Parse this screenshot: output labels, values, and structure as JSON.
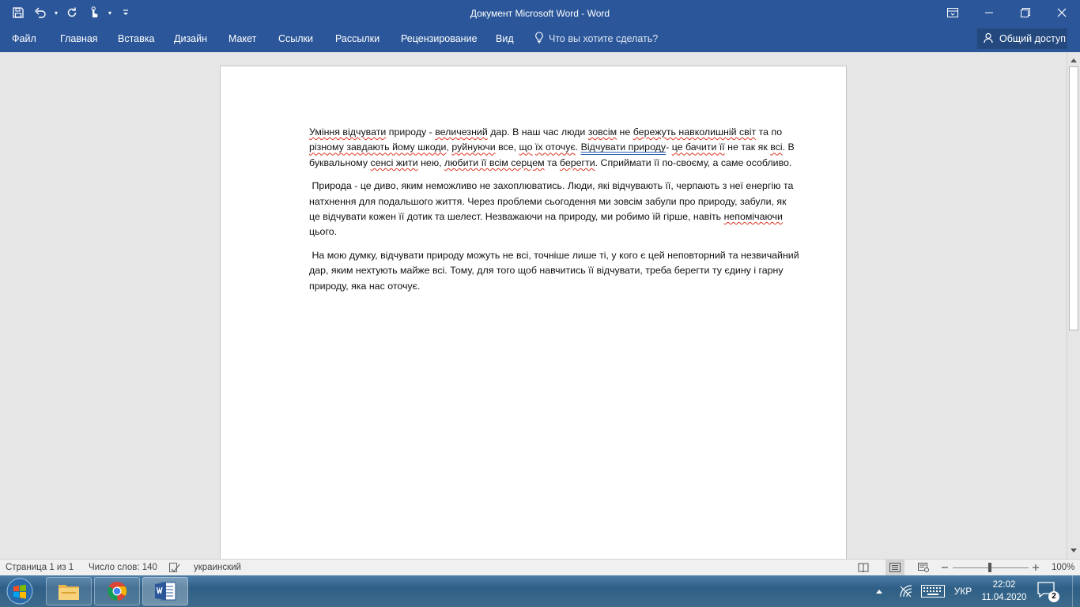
{
  "window": {
    "title": "Документ Microsoft Word - Word"
  },
  "quick_access": {
    "icons": [
      "save-icon",
      "undo-icon",
      "repeat-icon",
      "touch-mode-icon",
      "customize-icon"
    ]
  },
  "ribbon": {
    "tabs": [
      {
        "id": "file",
        "label": "Файл"
      },
      {
        "id": "home",
        "label": "Главная"
      },
      {
        "id": "insert",
        "label": "Вставка"
      },
      {
        "id": "design",
        "label": "Дизайн"
      },
      {
        "id": "layout",
        "label": "Макет"
      },
      {
        "id": "references",
        "label": "Ссылки"
      },
      {
        "id": "mailings",
        "label": "Рассылки"
      },
      {
        "id": "review",
        "label": "Рецензирование"
      },
      {
        "id": "view",
        "label": "Вид"
      }
    ],
    "tell_me": "Что вы хотите сделать?",
    "share": "Общий доступ"
  },
  "document": {
    "paragraphs": [
      [
        {
          "t": "Уміння відчувати",
          "e": "spell"
        },
        {
          "t": " природу - "
        },
        {
          "t": "величезний",
          "e": "spell"
        },
        {
          "t": " дар. В наш час люди "
        },
        {
          "t": "зовсім",
          "e": "spell"
        },
        {
          "t": " не "
        },
        {
          "t": "бережуть навколишній світ",
          "e": "spell"
        },
        {
          "t": " та по "
        },
        {
          "t": "різному завдають йому шкоди",
          "e": "spell"
        },
        {
          "t": ", "
        },
        {
          "t": "руйнуючи",
          "e": "spell"
        },
        {
          "t": " все, "
        },
        {
          "t": "що",
          "e": "spell"
        },
        {
          "t": " "
        },
        {
          "t": "їх оточує",
          "e": "spell"
        },
        {
          "t": ". "
        },
        {
          "t": "Відчувати природу",
          "e": "gram"
        },
        {
          "t": "- "
        },
        {
          "t": "це бачити її",
          "e": "spell"
        },
        {
          "t": " не так як "
        },
        {
          "t": "всі",
          "e": "spell"
        },
        {
          "t": ". В буквальному "
        },
        {
          "t": "сенсі жити",
          "e": "spell"
        },
        {
          "t": " нею, "
        },
        {
          "t": "любити її всім серцем",
          "e": "spell"
        },
        {
          "t": " та "
        },
        {
          "t": "берегти",
          "e": "spell"
        },
        {
          "t": ". Сприймати її по-своєму, а саме особливо."
        }
      ],
      [
        {
          "t": " Природа - це диво, яким неможливо не захоплюватись. Люди, які відчувають її, черпають з неї енергію та натхнення для подальшого життя. Через проблеми сьогодення ми зовсім забули про природу, забули, як це відчувати кожен її дотик та шелест. Незважаючи на природу, ми робимо їй гірше, навіть "
        },
        {
          "t": "непомічаючи",
          "e": "spell"
        },
        {
          "t": " цього."
        }
      ],
      [
        {
          "t": " На мою думку, відчувати природу можуть не всі, точніше лише ті, у кого є цей неповторний та незвичайний дар, яким нехтують майже всі. Тому, для того щоб навчитись її відчувати, треба берегти ту єдину і гарну природу, яка нас оточує."
        }
      ]
    ]
  },
  "statusbar": {
    "page": "Страница 1 из 1",
    "words": "Число слов: 140",
    "language": "украинский",
    "zoom": "100%"
  },
  "taskbar": {
    "apps": [
      "explorer-icon",
      "chrome-icon",
      "word-icon"
    ],
    "language": "УКР",
    "time": "22:02",
    "date": "11.04.2020",
    "notifications": "2"
  }
}
